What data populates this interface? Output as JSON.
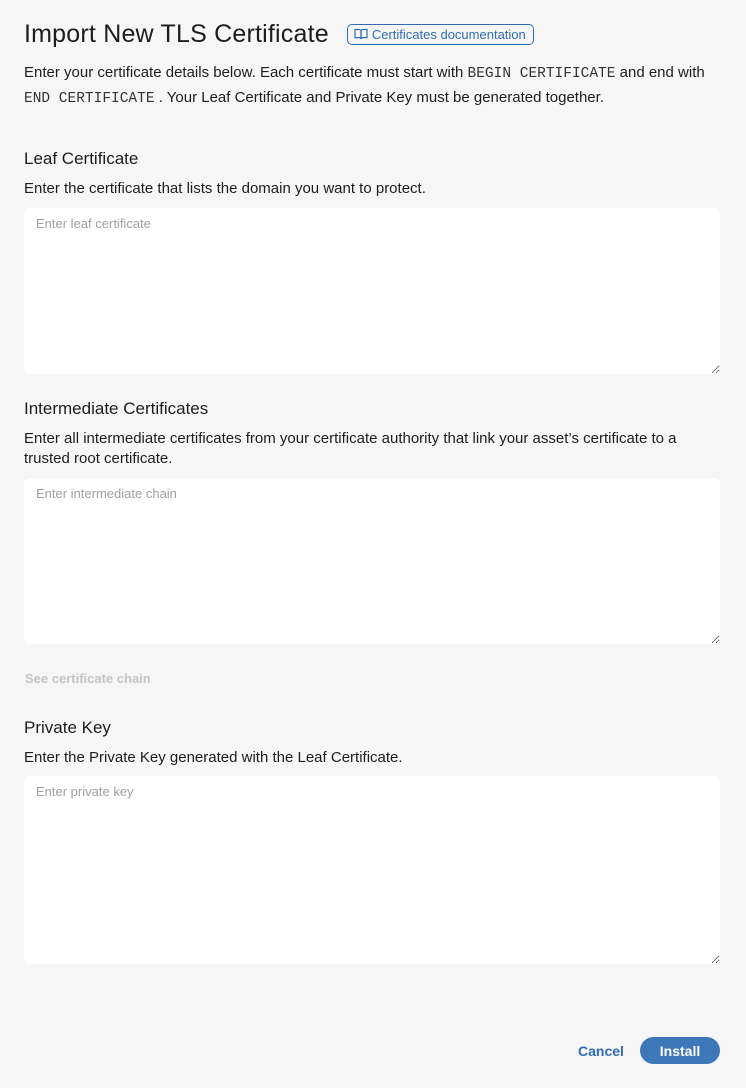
{
  "header": {
    "title": "Import New TLS Certificate",
    "doc_link_label": "Certificates documentation",
    "doc_link_icon": "book-open-icon"
  },
  "intro": {
    "part1": "Enter your certificate details below. Each certificate must start with ",
    "begin_code": "BEGIN CERTIFICATE",
    "part2": " and end with ",
    "end_code": "END CERTIFICATE",
    "part3": " . Your Leaf Certificate and Private Key must be generated together."
  },
  "leaf": {
    "title": "Leaf Certificate",
    "description": "Enter the certificate that lists the domain you want to protect.",
    "placeholder": "Enter leaf certificate",
    "value": ""
  },
  "intermediate": {
    "title": "Intermediate Certificates",
    "description": "Enter all intermediate certificates from your certificate authority that link your asset’s certificate to a trusted root certificate.",
    "placeholder": "Enter intermediate chain",
    "value": "",
    "see_chain_label": "See certificate chain"
  },
  "private_key": {
    "title": "Private Key",
    "description": "Enter the Private Key generated with the Leaf Certificate.",
    "placeholder": "Enter private key",
    "value": ""
  },
  "footer": {
    "cancel_label": "Cancel",
    "install_label": "Install"
  },
  "colors": {
    "accent": "#2f6db3",
    "primary_button": "#3e78b8",
    "background": "#f6f6f6",
    "disabled_text": "#c4c4c4"
  }
}
